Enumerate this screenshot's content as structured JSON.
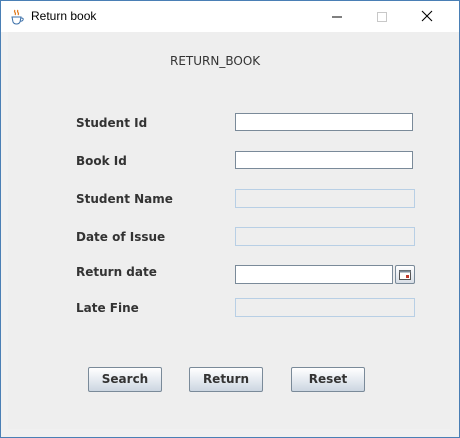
{
  "window": {
    "title": "Return book",
    "app_icon": "java-cup-icon",
    "controls": [
      "minimize-icon",
      "maximize-icon",
      "close-icon"
    ]
  },
  "form": {
    "heading": "RETURN_BOOK",
    "student_id": {
      "label": "Student Id",
      "value": ""
    },
    "book_id": {
      "label": "Book Id",
      "value": ""
    },
    "student_name": {
      "label": "Student Name",
      "value": "",
      "enabled": false
    },
    "date_of_issue": {
      "label": "Date of Issue",
      "value": "",
      "enabled": false
    },
    "return_date": {
      "label": "Return date",
      "value": "",
      "picker_icon": "calendar-icon"
    },
    "late_fine": {
      "label": "Late Fine",
      "value": "",
      "enabled": false
    }
  },
  "buttons": {
    "search": "Search",
    "return": "Return",
    "reset": "Reset"
  },
  "colors": {
    "window_border": "#4a7fb5",
    "content_background": "#eeeeee",
    "disabled_field_border": "#b8cfe5"
  }
}
